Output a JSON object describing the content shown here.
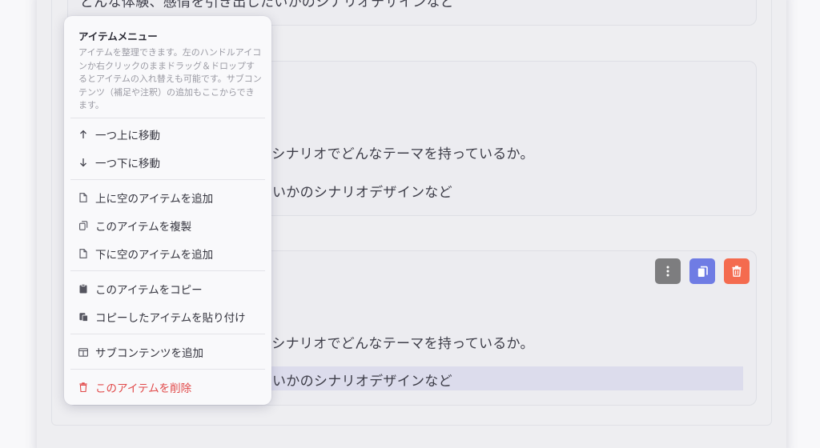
{
  "background": {
    "top_text": "どんな体験、感情を引き出したいかのシナリオデザインなど",
    "card1": {
      "line1": "なシナリオでどんなテーマを持っているか。",
      "line2": "いかのシナリオデザインなど"
    },
    "card2": {
      "line1": "なシナリオでどんなテーマを持っているか。",
      "line2": "いかのシナリオデザインなど"
    }
  },
  "actions": {
    "more_icon": "more-vertical-icon",
    "copy_icon": "copy-icon",
    "delete_icon": "trash-icon"
  },
  "menu": {
    "title": "アイテムメニュー",
    "description": "アイテムを整理できます。左のハンドルアイコンか右クリックのままドラッグ＆ドロップするとアイテムの入れ替えも可能です。サブコンテンツ（補足や注釈）の追加もここからできます。",
    "items": [
      {
        "label": "一つ上に移動",
        "icon": "arrow-up-icon"
      },
      {
        "label": "一つ下に移動",
        "icon": "arrow-down-icon"
      },
      {
        "label": "上に空のアイテムを追加",
        "icon": "file-icon"
      },
      {
        "label": "このアイテムを複製",
        "icon": "duplicate-icon"
      },
      {
        "label": "下に空のアイテムを追加",
        "icon": "file-icon"
      },
      {
        "label": "このアイテムをコピー",
        "icon": "clipboard-icon"
      },
      {
        "label": "コピーしたアイテムを貼り付け",
        "icon": "paste-icon"
      },
      {
        "label": "サブコンテンツを追加",
        "icon": "columns-icon"
      },
      {
        "label": "このアイテムを削除",
        "icon": "trash-icon"
      }
    ]
  },
  "colors": {
    "accent": "#6f7ce4",
    "danger": "#f46b4f",
    "danger_text": "#e14848",
    "neutral_button": "#7d7d7f",
    "highlight": "#dcdcec"
  }
}
